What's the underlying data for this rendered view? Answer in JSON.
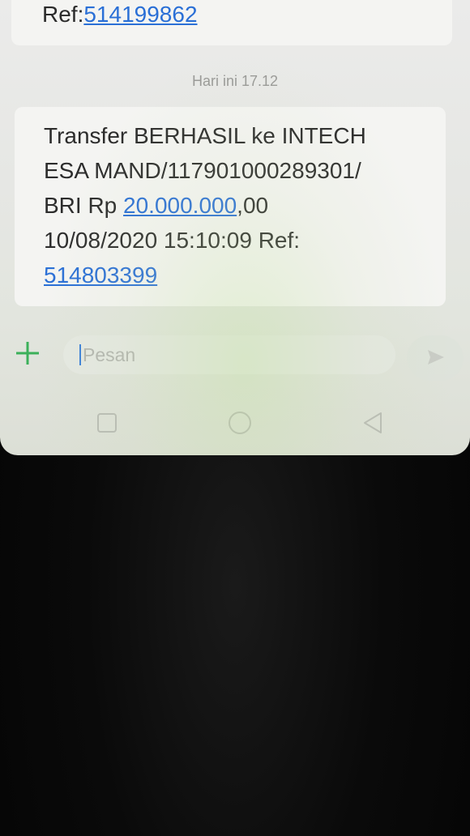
{
  "conversation": {
    "previous_message": {
      "ref_prefix": "Ref:",
      "ref_number": "514199862"
    },
    "date_separator": "Hari ini 17.12",
    "message": {
      "line1": "Transfer BERHASIL ke INTECH",
      "line2": "ESA MAND/117901000289301/",
      "line3_prefix": "BRI Rp ",
      "amount_link": "20.000.000",
      "amount_suffix": ",00",
      "line4": "10/08/2020 15:10:09 Ref:",
      "ref_link": "514803399"
    }
  },
  "composer": {
    "placeholder": "Pesan",
    "add_icon": "plus-icon",
    "send_icon": "send-icon"
  },
  "navigation": {
    "recent_icon": "square-icon",
    "home_icon": "circle-icon",
    "back_icon": "triangle-back-icon"
  },
  "colors": {
    "link": "#2a6fd6",
    "add_button": "#3bb05a",
    "caret": "#3a7fd9"
  }
}
